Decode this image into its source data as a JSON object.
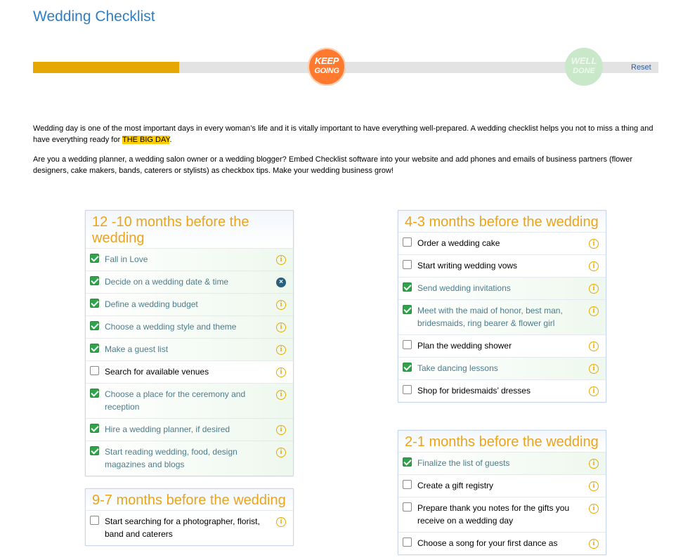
{
  "page": {
    "title": "Wedding Checklist",
    "reset_label": "Reset",
    "progress_percent": 23.4,
    "badges": {
      "keep_line1": "KEEP",
      "keep_line2": "GOING",
      "done_line1": "WELL",
      "done_line2": "DONE"
    },
    "colors": {
      "title": "#2f7fc4",
      "progress": "#e6a800",
      "heading": "#eba41a",
      "check": "#2fa24a"
    }
  },
  "intro": {
    "p1_text": "Wedding day is one of the most important days in every woman’s life and it is vitally important to have everything well-prepared.  A wedding checklist helps you not to miss a thing and have everything ready for ",
    "p1_highlight": "THE BIG DAY",
    "p1_end": ".",
    "p2_text": "Are you a wedding planner, a wedding salon owner or a wedding blogger? Embed Checklist software into your website and add  phones and emails of  business partners (flower designers, cake makers, bands, caterers or stylists) as checkbox tips. Make your wedding business grow!"
  },
  "cards": [
    {
      "heading": "12 -10 months before the wedding",
      "items": [
        {
          "label": "Fall in Love",
          "checked": true,
          "icon": "info-icon"
        },
        {
          "label": "Decide on a wedding date & time",
          "checked": true,
          "icon": "close-circle-icon"
        },
        {
          "label": "Define a wedding budget",
          "checked": true,
          "icon": "info-icon"
        },
        {
          "label": "Choose a wedding style and theme",
          "checked": true,
          "icon": "info-icon"
        },
        {
          "label": "Make a guest list",
          "checked": true,
          "icon": "info-icon"
        },
        {
          "label": "Search for available venues",
          "checked": false,
          "icon": "info-icon"
        },
        {
          "label": "Choose a place for the ceremony and reception",
          "checked": true,
          "icon": "info-icon"
        },
        {
          "label": "Hire a wedding planner, if desired",
          "checked": true,
          "icon": "info-icon"
        },
        {
          "label": "Start reading wedding, food, design magazines and blogs",
          "checked": true,
          "icon": "info-icon"
        }
      ]
    },
    {
      "heading": "9-7 months before the wedding",
      "items": [
        {
          "label": "Start searching for a photographer, florist, band and caterers",
          "checked": false,
          "icon": "info-icon"
        }
      ]
    },
    {
      "heading": "4-3 months before the wedding",
      "items": [
        {
          "label": "Order a wedding cake",
          "checked": false,
          "icon": "info-icon"
        },
        {
          "label": "Start writing wedding vows",
          "checked": false,
          "icon": "info-icon"
        },
        {
          "label": "Send wedding invitations",
          "checked": true,
          "icon": "info-icon"
        },
        {
          "label": "Meet with the maid of honor, best man, bridesmaids, ring bearer & flower girl",
          "checked": true,
          "icon": "info-icon"
        },
        {
          "label": "Plan the wedding shower",
          "checked": false,
          "icon": "info-icon"
        },
        {
          "label": "Take dancing lessons",
          "checked": true,
          "icon": "info-icon"
        },
        {
          "label": "Shop for bridesmaids’ dresses",
          "checked": false,
          "icon": "info-icon"
        }
      ]
    },
    {
      "heading": "2-1 months before the wedding",
      "items": [
        {
          "label": "Finalize the list of guests",
          "checked": true,
          "icon": "info-icon"
        },
        {
          "label": "Create a gift registry",
          "checked": false,
          "icon": "info-icon"
        },
        {
          "label": "Prepare thank you notes for the gifts you receive on a wedding day",
          "checked": false,
          "icon": "info-icon"
        },
        {
          "label": "Choose a song for your first dance as",
          "checked": false,
          "icon": "info-icon"
        }
      ]
    }
  ]
}
